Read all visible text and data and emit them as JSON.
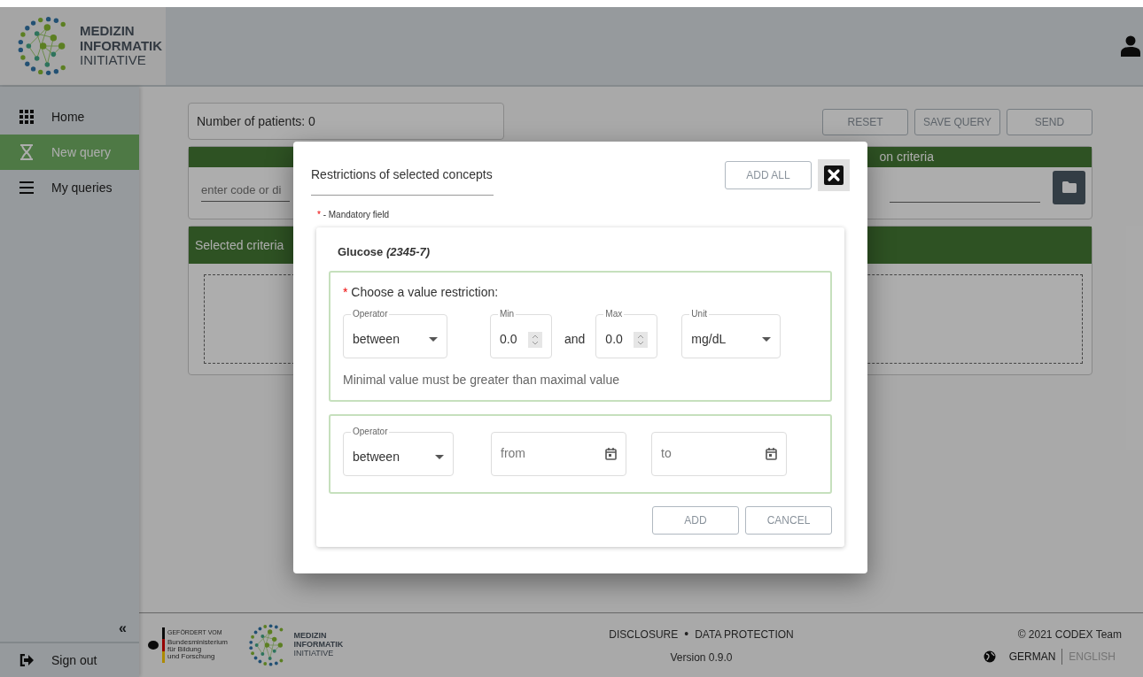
{
  "header": {
    "logo": {
      "lines": [
        "MEDIZIN",
        "INFORMATIK",
        "INITIATIVE"
      ]
    }
  },
  "sidebar": {
    "items": [
      {
        "label": "Home",
        "selected": false
      },
      {
        "label": "New query",
        "selected": true
      },
      {
        "label": "My queries",
        "selected": false
      }
    ],
    "collapse": "«",
    "sign_out": "Sign out"
  },
  "main": {
    "patient_count": "Number of patients: 0",
    "buttons": [
      "RESET",
      "SAVE QUERY",
      "SEND"
    ],
    "inclusion": {
      "placeholder": "enter code or di"
    },
    "exclusion": {
      "title": "on criteria"
    },
    "selected_criteria": {
      "title": "Selected criteria"
    }
  },
  "dialog": {
    "title": "Restrictions of selected concepts",
    "add_all": "ADD ALL",
    "mandatory_note": {
      "mark": "*",
      "text": "- Mandatory field"
    },
    "concept": "Glucose *(2345-7)*",
    "value_restriction": {
      "mark": "*",
      "label": "Choose a value restriction:",
      "operator": {
        "label": "Operator",
        "value": "between"
      },
      "min": {
        "label": "Min",
        "value": "0.0"
      },
      "joiner": "and",
      "max": {
        "label": "Max",
        "value": "0.0"
      },
      "unit": {
        "label": "Unit",
        "value": "mg/dL"
      },
      "message": "Minimal value must be greater than maximal value"
    },
    "time_restriction": {
      "operator": {
        "label": "Operator",
        "value": "between"
      },
      "from": {
        "placeholder": "from"
      },
      "to": {
        "placeholder": "to"
      }
    },
    "buttons": [
      "ADD",
      "CANCEL"
    ]
  },
  "footer": {
    "funder": {
      "caption": "GEFÖRDERT VOM",
      "lines": [
        "Bundesministerium",
        "für Bildung",
        "und Forschung"
      ]
    },
    "logo": {
      "lines": [
        "MEDIZIN",
        "INFORMATIK",
        "INITIATIVE"
      ]
    },
    "links": [
      "DISCLOSURE",
      "DATA PROTECTION"
    ],
    "separator": "•",
    "version": "Version 0.9.0",
    "copyright": "© 2021 CODEX Team",
    "languages": [
      {
        "label": "GERMAN",
        "selected": true
      },
      {
        "label": "ENGLISH",
        "selected": false
      }
    ]
  }
}
